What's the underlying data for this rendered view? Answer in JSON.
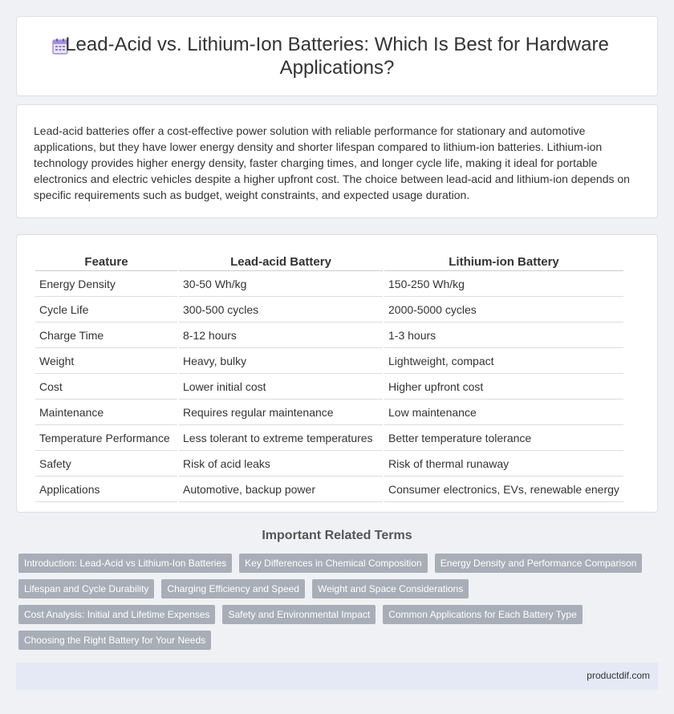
{
  "header": {
    "icon": "calendar-icon",
    "title": "Lead-Acid vs. Lithium-Ion Batteries: Which Is Best for Hardware Applications?"
  },
  "summary": {
    "text": "Lead-acid batteries offer a cost-effective power solution with reliable performance for stationary and automotive applications, but they have lower energy density and shorter lifespan compared to lithium-ion batteries. Lithium-ion technology provides higher energy density, faster charging times, and longer cycle life, making it ideal for portable electronics and electric vehicles despite a higher upfront cost. The choice between lead-acid and lithium-ion depends on specific requirements such as budget, weight constraints, and expected usage duration."
  },
  "table": {
    "headers": [
      "Feature",
      "Lead-acid Battery",
      "Lithium-ion Battery"
    ],
    "rows": [
      [
        "Energy Density",
        "30-50 Wh/kg",
        "150-250 Wh/kg"
      ],
      [
        "Cycle Life",
        "300-500 cycles",
        "2000-5000 cycles"
      ],
      [
        "Charge Time",
        "8-12 hours",
        "1-3 hours"
      ],
      [
        "Weight",
        "Heavy, bulky",
        "Lightweight, compact"
      ],
      [
        "Cost",
        "Lower initial cost",
        "Higher upfront cost"
      ],
      [
        "Maintenance",
        "Requires regular maintenance",
        "Low maintenance"
      ],
      [
        "Temperature Performance",
        "Less tolerant to extreme temperatures",
        "Better temperature tolerance"
      ],
      [
        "Safety",
        "Risk of acid leaks",
        "Risk of thermal runaway"
      ],
      [
        "Applications",
        "Automotive, backup power",
        "Consumer electronics, EVs, renewable energy"
      ]
    ]
  },
  "related": {
    "heading": "Important Related Terms",
    "tags": [
      "Introduction: Lead-Acid vs Lithium-Ion Batteries",
      "Key Differences in Chemical Composition",
      "Energy Density and Performance Comparison",
      "Lifespan and Cycle Durability",
      "Charging Efficiency and Speed",
      "Weight and Space Considerations",
      "Cost Analysis: Initial and Lifetime Expenses",
      "Safety and Environmental Impact",
      "Common Applications for Each Battery Type",
      "Choosing the Right Battery for Your Needs"
    ]
  },
  "footer": {
    "site": "productdif.com"
  }
}
